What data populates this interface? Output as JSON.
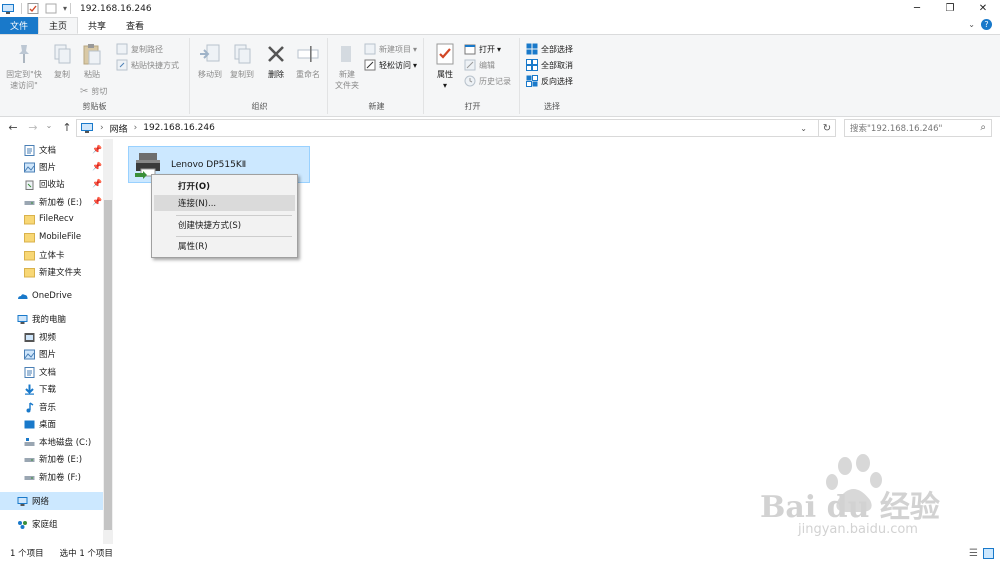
{
  "window": {
    "title": "192.168.16.246",
    "minimize_glyph": "─",
    "restore_glyph": "❐",
    "close_glyph": "✕"
  },
  "tabs": [
    {
      "label": "文件"
    },
    {
      "label": "主页"
    },
    {
      "label": "共享"
    },
    {
      "label": "查看"
    }
  ],
  "ribbon": {
    "clipboard": {
      "pin_label_1": "固定到\"快",
      "pin_label_2": "速访问\"",
      "copy_label": "复制",
      "paste_label": "粘贴",
      "copy_path_label": "复制路径",
      "paste_shortcut_label": "粘贴快捷方式",
      "cut_label": "剪切",
      "group_label": "剪贴板"
    },
    "organize": {
      "move_to_label": "移动到",
      "copy_to_label": "复制到",
      "delete_label": "删除",
      "rename_label": "重命名",
      "group_label": "组织"
    },
    "new": {
      "new_folder_label_1": "新建",
      "new_folder_label_2": "文件夹",
      "new_item_label": "新建项目",
      "easy_access_label": "轻松访问",
      "group_label": "新建"
    },
    "open": {
      "properties_label": "属性",
      "open_label": "打开",
      "edit_label": "编辑",
      "history_label": "历史记录",
      "group_label": "打开"
    },
    "select": {
      "select_all_label": "全部选择",
      "select_none_label": "全部取消",
      "invert_label": "反向选择",
      "group_label": "选择"
    }
  },
  "address": {
    "crumb_network": "网络",
    "crumb_host": "192.168.16.246",
    "chevron": "›",
    "search_placeholder": "搜索\"192.168.16.246\""
  },
  "nav": {
    "quick": [
      {
        "label": "文档"
      },
      {
        "label": "图片"
      },
      {
        "label": "回收站"
      },
      {
        "label": "新加卷 (E:)"
      },
      {
        "label": "FileRecv"
      },
      {
        "label": "MobileFile"
      },
      {
        "label": "立体卡"
      },
      {
        "label": "新建文件夹"
      }
    ],
    "onedrive": "OneDrive",
    "thispc": "我的电脑",
    "pc_items": [
      {
        "label": "视频"
      },
      {
        "label": "图片"
      },
      {
        "label": "文档"
      },
      {
        "label": "下载"
      },
      {
        "label": "音乐"
      },
      {
        "label": "桌面"
      },
      {
        "label": "本地磁盘 (C:)"
      },
      {
        "label": "新加卷 (E:)"
      },
      {
        "label": "新加卷 (F:)"
      }
    ],
    "network": "网络",
    "homegroup": "家庭组"
  },
  "content": {
    "item_label": "Lenovo DP515KⅡ"
  },
  "context_menu": {
    "open": "打开(O)",
    "connect": "连接(N)...",
    "create_shortcut": "创建快捷方式(S)",
    "properties": "属性(R)"
  },
  "status": {
    "count": "1 个项目",
    "selected": "选中 1 个项目"
  },
  "watermark": {
    "brand": "Bai du 经验",
    "url": "jingyan.baidu.com"
  },
  "colors": {
    "accent": "#1979ca",
    "selection": "#cce8ff",
    "selection_border": "#99d1ff"
  }
}
